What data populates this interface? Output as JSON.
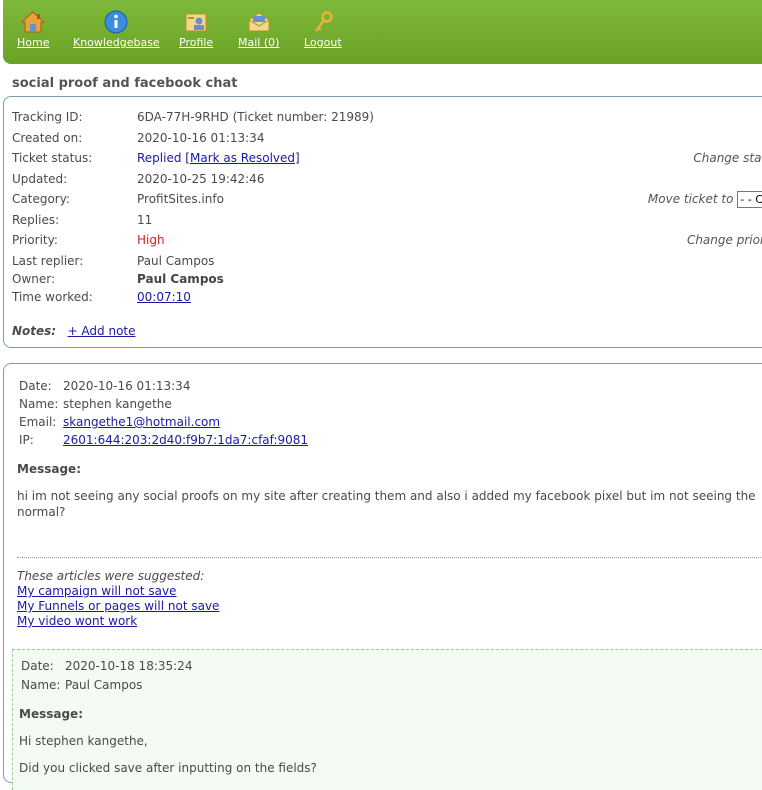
{
  "nav": {
    "home": "Home",
    "knowledgebase": "Knowledgebase",
    "profile": "Profile",
    "mail": "Mail (0)",
    "logout": "Logout"
  },
  "page_title": "social proof and facebook chat",
  "ticket": {
    "tracking_label": "Tracking ID:",
    "tracking_value": "6DA-77H-9RHD (Ticket number: 21989)",
    "created_label": "Created on:",
    "created_value": "2020-10-16 01:13:34",
    "status_label": "Ticket status:",
    "status_value": "Replied",
    "mark_resolved": "Mark as Resolved",
    "updated_label": "Updated:",
    "updated_value": "2020-10-25 19:42:46",
    "category_label": "Category:",
    "category_value": "ProfitSites.info",
    "replies_label": "Replies:",
    "replies_value": "11",
    "priority_label": "Priority:",
    "priority_value": "High",
    "last_replier_label": "Last replier:",
    "last_replier_value": "Paul Campos",
    "owner_label": "Owner:",
    "owner_value": "Paul Campos",
    "time_worked_label": "Time worked:",
    "time_worked_value": "00:07:10",
    "notes_label": "Notes:",
    "add_note": "+ Add note",
    "change_status": "Change status",
    "move_ticket": "Move ticket to",
    "move_select": "- - Cli",
    "change_priority": "Change priority"
  },
  "message1": {
    "date_label": "Date:",
    "date_value": "2020-10-16 01:13:34",
    "name_label": "Name:",
    "name_value": "stephen kangethe",
    "email_label": "Email:",
    "email_value": "skangethe1@hotmail.com",
    "ip_label": "IP:",
    "ip_value": "2601:644:203:2d40:f9b7:1da7:cfaf:9081",
    "message_label": "Message:",
    "body_line1": "hi im not seeing any social proofs on my site after creating them and also i added my facebook pixel but im not seeing the",
    "body_line2": "normal?",
    "suggested_label": "These articles were suggested:",
    "suggested": [
      "My campaign will not save",
      "My Funnels or pages will not save",
      "My video wont work"
    ]
  },
  "message2": {
    "date_label": "Date:",
    "date_value": "2020-10-18 18:35:24",
    "name_label": "Name:",
    "name_value": "Paul Campos",
    "message_label": "Message:",
    "greeting": "Hi stephen kangethe,",
    "body_line1": "Did you clicked save after inputting on the fields?"
  },
  "colors": {
    "nav_green": "#6aa324",
    "link": "#1a1aa6",
    "priority_high": "#d22222"
  }
}
